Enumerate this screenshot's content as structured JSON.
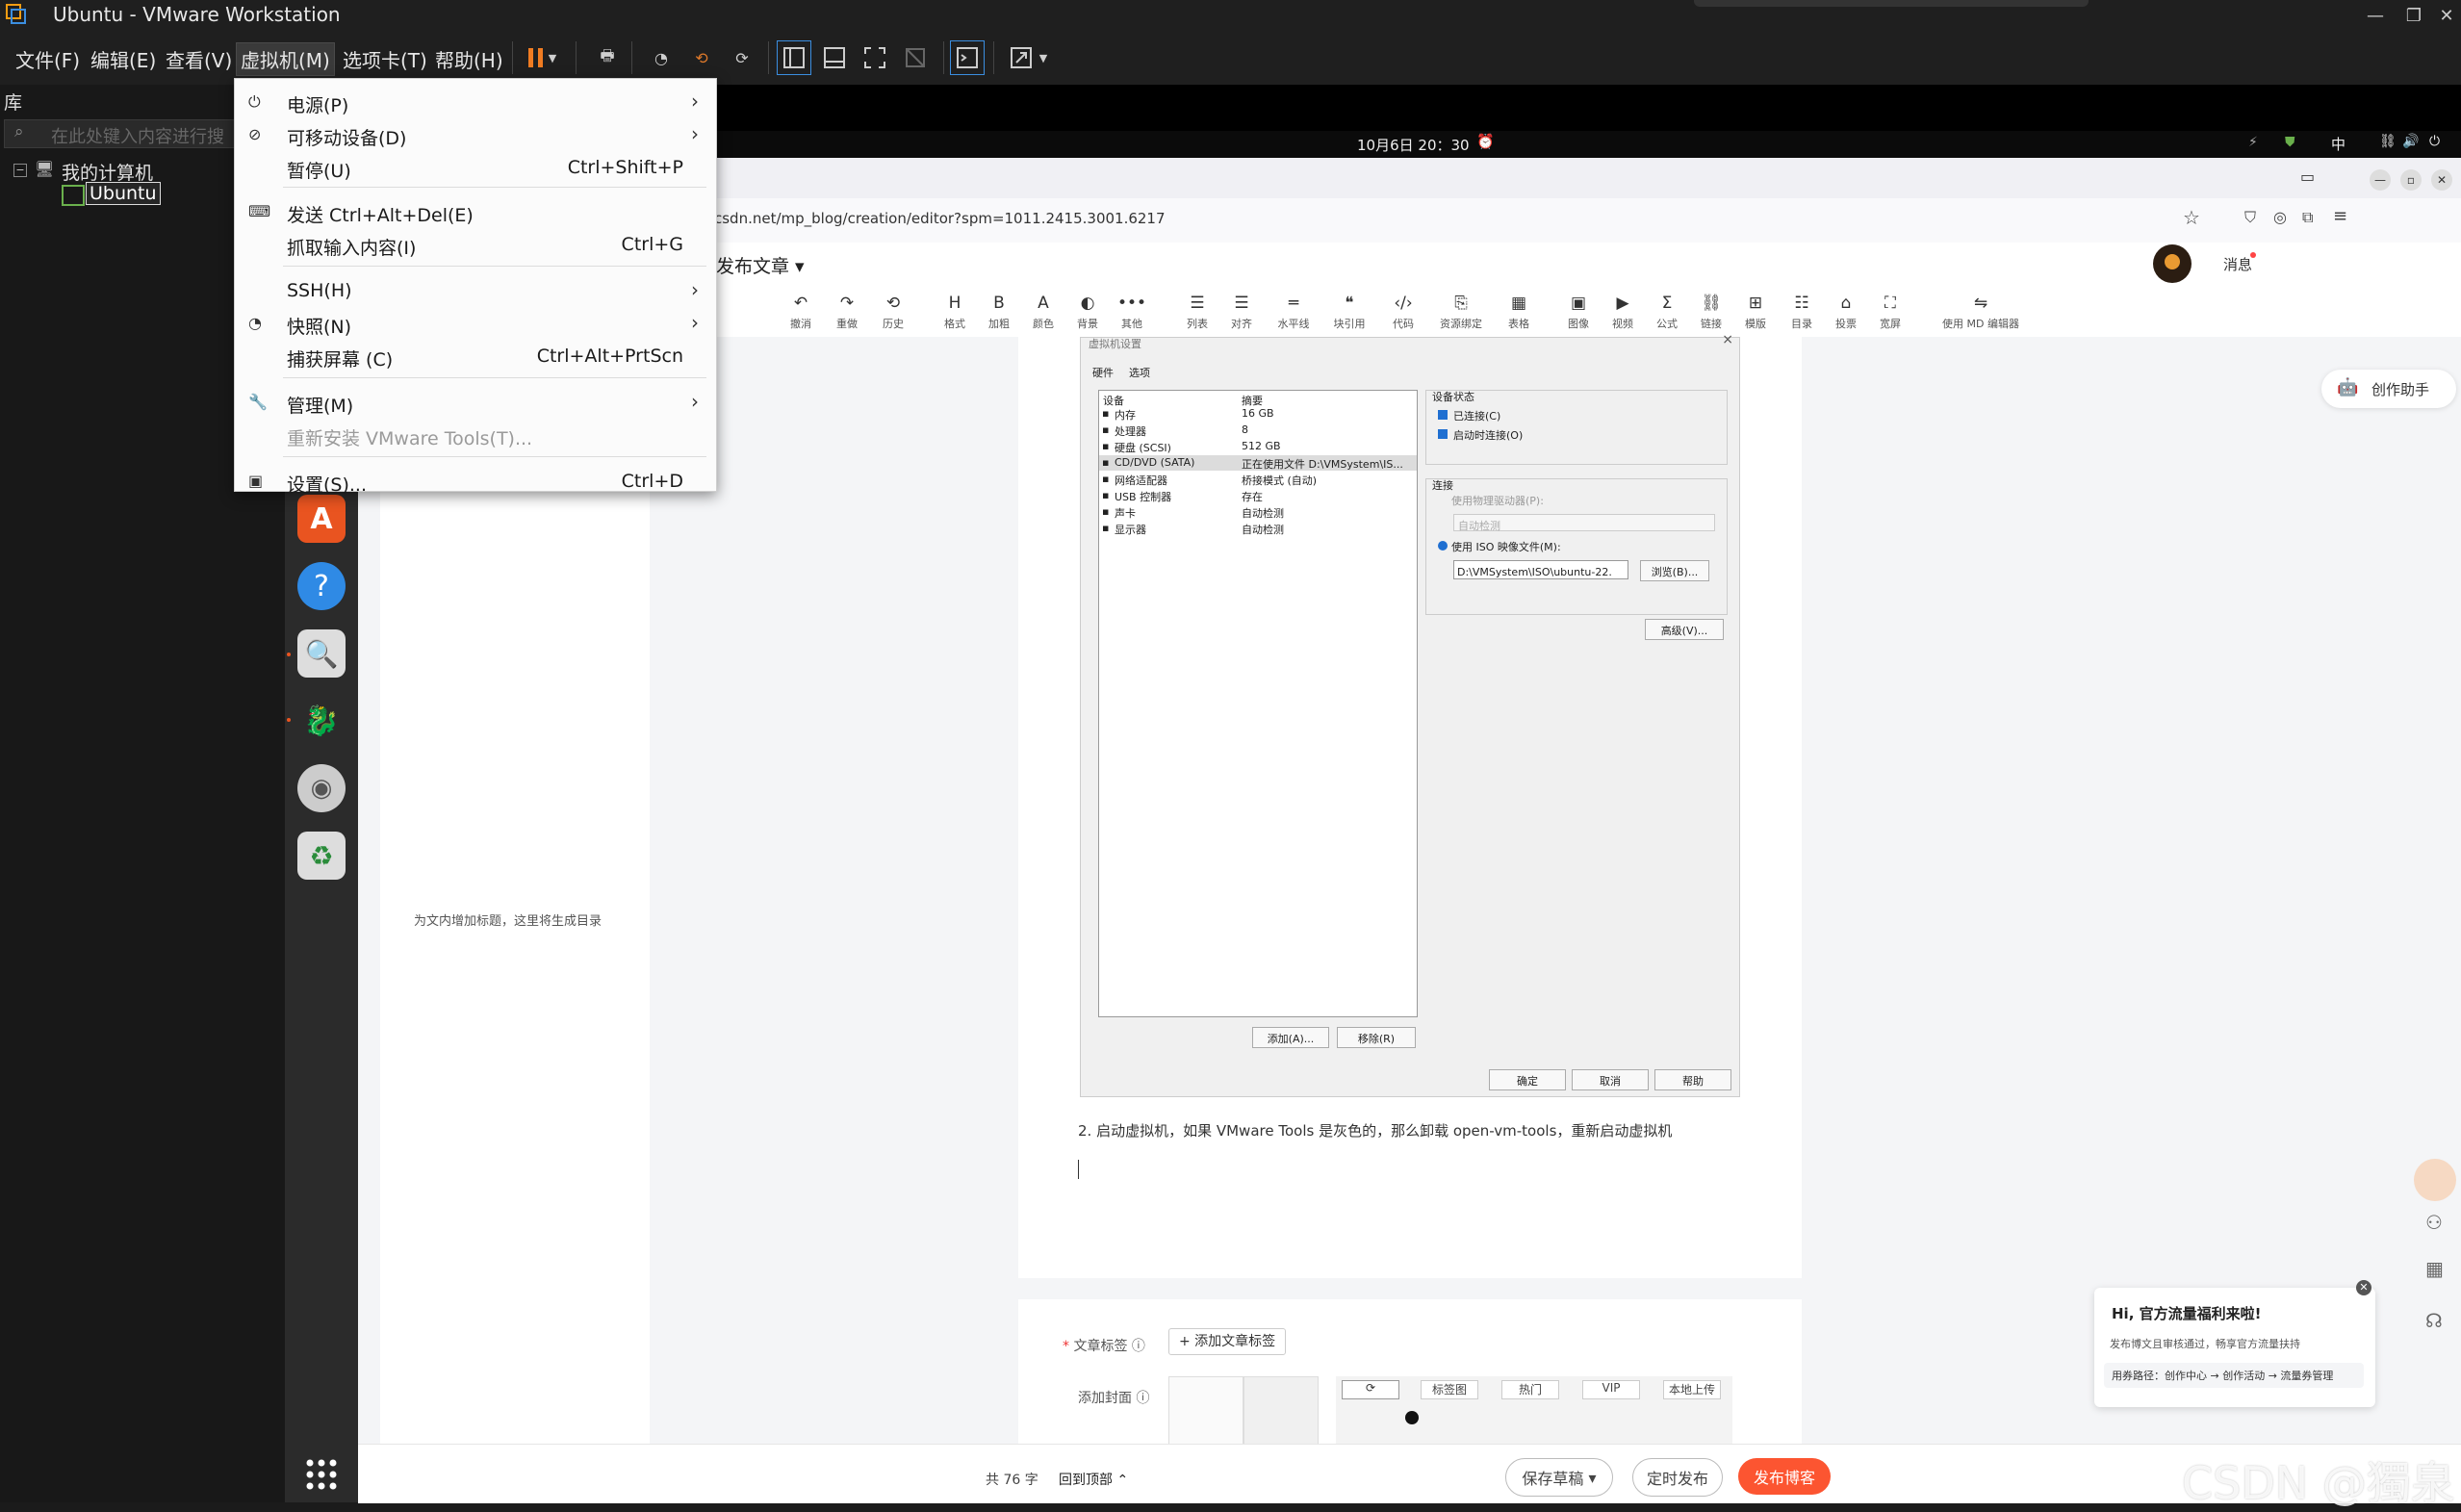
{
  "window": {
    "title": "Ubuntu - VMware Workstation"
  },
  "menubar": {
    "items": [
      "文件(F)",
      "编辑(E)",
      "查看(V)",
      "虚拟机(M)",
      "选项卡(T)",
      "帮助(H)"
    ]
  },
  "library": {
    "label": "库",
    "search_placeholder": "在此处键入内容进行搜",
    "tree": {
      "root": "我的计算机",
      "child": "Ubuntu"
    }
  },
  "context_menu": {
    "items": [
      {
        "label": "电源(P)",
        "shortcut": "",
        "submenu": true,
        "icon": "power-icon"
      },
      {
        "label": "可移动设备(D)",
        "shortcut": "",
        "submenu": true,
        "icon": "usb-icon"
      },
      {
        "label": "暂停(U)",
        "shortcut": "Ctrl+Shift+P",
        "submenu": false,
        "icon": ""
      },
      {
        "label": "发送 Ctrl+Alt+Del(E)",
        "shortcut": "",
        "submenu": false,
        "icon": "keyboard-icon"
      },
      {
        "label": "抓取输入内容(I)",
        "shortcut": "Ctrl+G",
        "submenu": false,
        "icon": ""
      },
      {
        "label": "SSH(H)",
        "shortcut": "",
        "submenu": true,
        "icon": ""
      },
      {
        "label": "快照(N)",
        "shortcut": "",
        "submenu": true,
        "icon": "snapshot-icon"
      },
      {
        "label": "捕获屏幕 (C)",
        "shortcut": "Ctrl+Alt+PrtScn",
        "submenu": false,
        "icon": ""
      },
      {
        "label": "管理(M)",
        "shortcut": "",
        "submenu": true,
        "icon": "wrench-icon"
      },
      {
        "label": "重新安装 VMware Tools(T)...",
        "shortcut": "",
        "submenu": false,
        "icon": "",
        "disabled": true
      },
      {
        "label": "设置(S)...",
        "shortcut": "Ctrl+D",
        "submenu": false,
        "icon": "settings-icon"
      }
    ]
  },
  "guest": {
    "clock": "10月6日 20：30",
    "tray_lang": "中",
    "browser": {
      "url": "csdn.net/mp_blog/creation/editor?spm=1011.2415.3001.6217",
      "page_title": "发布文章",
      "messages": "消息",
      "assistant": "创作助手",
      "toolbar": [
        "撤消",
        "重做",
        "历史",
        "格式",
        "加粗",
        "颜色",
        "背景",
        "其他",
        "列表",
        "对齐",
        "水平线",
        "块引用",
        "代码",
        "资源绑定",
        "表格",
        "图像",
        "视频",
        "公式",
        "链接",
        "模版",
        "目录",
        "投票",
        "宽屏",
        "使用 MD 编辑器"
      ],
      "toc_hint": "为文内增加标题，这里将生成目录",
      "paragraph": "2. 启动虚拟机，如果 VMware Tools 是灰色的，那么卸载 open-vm-tools，重新启动虚拟机",
      "tags_label": "文章标签",
      "add_tag": "+ 添加文章标签",
      "cover_label": "添加封面",
      "cover_tabs": [
        "标签图",
        "热门",
        "VIP",
        "本地上传"
      ],
      "word_count": "共 76 字",
      "back_top": "回到顶部",
      "save_draft": "保存草稿",
      "schedule": "定时发布",
      "publish": "发布博客",
      "promo_title": "Hi, 官方流量福利来啦!",
      "promo_text": "发布博文且审核通过，畅享官方流量扶持",
      "promo_path": "用券路径：创作中心 → 创作活动 → 流量券管理",
      "watermark": "CSDN @獨泉"
    },
    "dialog": {
      "title": "虚拟机设置",
      "tabs": [
        "硬件",
        "选项"
      ],
      "headers": [
        "设备",
        "摘要"
      ],
      "devices": [
        [
          "内存",
          "16 GB"
        ],
        [
          "处理器",
          "8"
        ],
        [
          "硬盘 (SCSI)",
          "512 GB"
        ],
        [
          "CD/DVD (SATA)",
          "正在使用文件 D:\\VMSystem\\IS..."
        ],
        [
          "网络适配器",
          "桥接模式 (自动)"
        ],
        [
          "USB 控制器",
          "存在"
        ],
        [
          "声卡",
          "自动检测"
        ],
        [
          "显示器",
          "自动检测"
        ]
      ],
      "status_group": "设备状态",
      "connected": "已连接(C)",
      "connect_on_start": "启动时连接(O)",
      "connection_group": "连接",
      "physical_drive": "使用物理驱动器(P):",
      "auto_detect": "自动检测",
      "use_iso": "使用 ISO 映像文件(M):",
      "iso_path": "D:\\VMSystem\\ISO\\ubuntu-22.",
      "browse": "浏览(B)...",
      "advanced": "高级(V)...",
      "add": "添加(A)...",
      "remove": "移除(R)",
      "ok": "确定",
      "cancel": "取消",
      "help": "帮助"
    }
  }
}
